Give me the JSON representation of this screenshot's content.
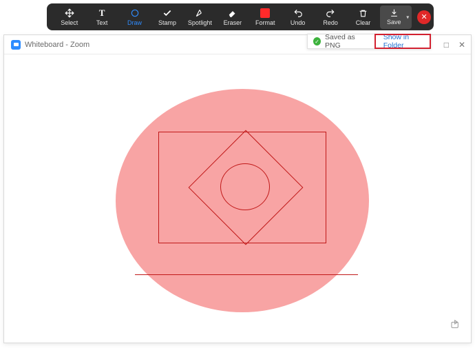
{
  "toolbar": {
    "select": "Select",
    "text": "Text",
    "draw": "Draw",
    "stamp": "Stamp",
    "spotlight": "Spotlight",
    "eraser": "Eraser",
    "format": "Format",
    "undo": "Undo",
    "redo": "Redo",
    "clear": "Clear",
    "save": "Save"
  },
  "window": {
    "title": "Whiteboard - Zoom"
  },
  "toast": {
    "saved": "Saved as PNG",
    "show": "Show in Folder"
  }
}
